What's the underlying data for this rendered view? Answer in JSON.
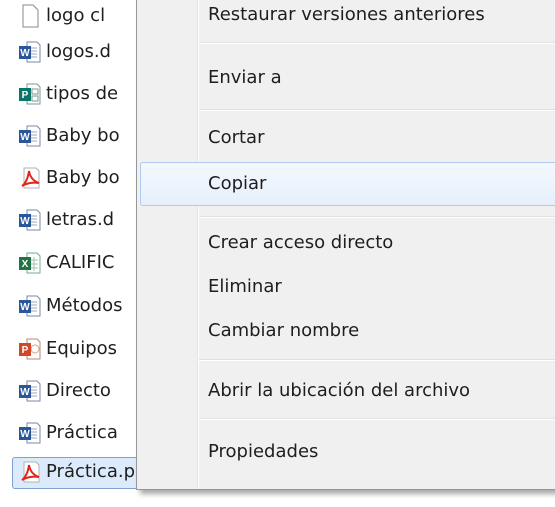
{
  "file_list": {
    "files": [
      {
        "name": "logo cl",
        "type": "generic"
      },
      {
        "name": "logos.d",
        "type": "word"
      },
      {
        "name": "tipos de",
        "type": "publisher"
      },
      {
        "name": "Baby bo",
        "type": "word"
      },
      {
        "name": "Baby bo",
        "type": "pdf"
      },
      {
        "name": "letras.d",
        "type": "word"
      },
      {
        "name": "CALIFIC",
        "type": "excel"
      },
      {
        "name": "Métodos",
        "type": "word"
      },
      {
        "name": "Equipos",
        "type": "powerpoint"
      },
      {
        "name": "Directo",
        "type": "word"
      },
      {
        "name": "Práctica",
        "type": "word"
      },
      {
        "name": "Práctica.pdf",
        "type": "pdf",
        "selected": true
      }
    ]
  },
  "context_menu": {
    "items": {
      "restore": "Restaurar versiones anteriores",
      "send_to": "Enviar a",
      "cut": "Cortar",
      "copy": "Copiar",
      "create_shortcut": "Crear acceso directo",
      "delete": "Eliminar",
      "rename": "Cambiar nombre",
      "open_location": "Abrir la ubicación del archivo",
      "properties": "Propiedades"
    },
    "hovered_item": "copy"
  },
  "colors": {
    "word": "#2b579a",
    "excel": "#217346",
    "powerpoint": "#d24726",
    "publisher": "#077568",
    "pdf": "#e0261b",
    "menu_bg": "#f0f0f0",
    "hover_border": "#aeccf1",
    "selection_bg": "#dcebfc"
  }
}
